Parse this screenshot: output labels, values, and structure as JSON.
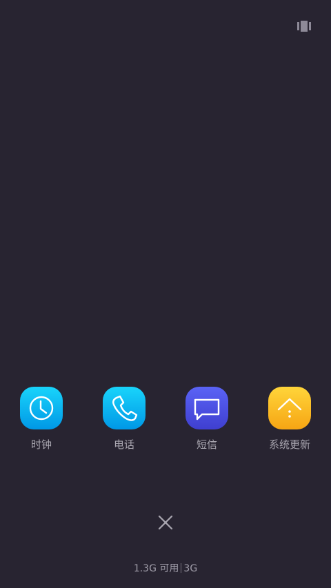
{
  "header": {
    "view_toggle_icon": "card-view-icon"
  },
  "recent_apps": [
    {
      "label": "时钟",
      "icon": "clock-icon",
      "color_top": "#19d4fb",
      "color_bottom": "#0098e6"
    },
    {
      "label": "电话",
      "icon": "phone-icon",
      "color_top": "#19d4fb",
      "color_bottom": "#0098e6"
    },
    {
      "label": "短信",
      "icon": "message-icon",
      "color_top": "#5a63f5",
      "color_bottom": "#3f3fd0"
    },
    {
      "label": "系统更新",
      "icon": "system-update-icon",
      "color_top": "#ffd53a",
      "color_bottom": "#f6a514"
    }
  ],
  "footer": {
    "close_icon": "close-icon",
    "memory_available": "1.3G 可用",
    "memory_total": "3G"
  }
}
